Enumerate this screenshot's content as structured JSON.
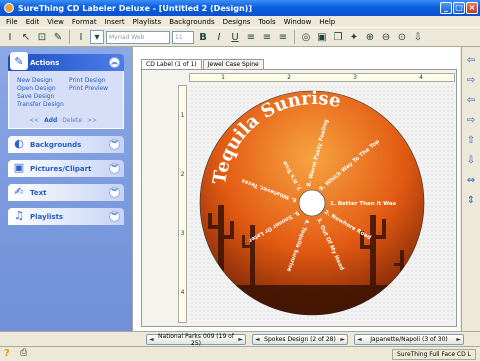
{
  "window": {
    "title": "SureThing CD Labeler Deluxe - [Untitled 2 (Design)]",
    "minimize": "_",
    "maximize": "□",
    "close": "×"
  },
  "menu": [
    "File",
    "Edit",
    "View",
    "Format",
    "Insert",
    "Playlists",
    "Backgrounds",
    "Designs",
    "Tools",
    "Window",
    "Help"
  ],
  "toolbar": {
    "font": "Myriad Web",
    "size": "11",
    "bold": "B",
    "italic": "I",
    "underline": "U"
  },
  "panel": {
    "actions": {
      "title": "Actions",
      "links": [
        "New Design",
        "Print Design",
        "Open Design",
        "Print Preview",
        "Save Design",
        "",
        "Transfer Design",
        ""
      ],
      "add": "Add",
      "delete": "Delete",
      "arrows": "<< >>"
    },
    "sections": [
      "Backgrounds",
      "Pictures/Clipart",
      "Text",
      "Playlists"
    ]
  },
  "tabs": [
    "CD Label (1 of 1)",
    "Jewel Case Spine"
  ],
  "ruler": {
    "h": [
      "1",
      "2",
      "3",
      "4"
    ],
    "v": [
      "1",
      "2",
      "3",
      "4"
    ]
  },
  "label": {
    "title": "Tequila Sunrise",
    "tracks": [
      "1. Better Than It Was",
      "2. Nowhere Road",
      "3. Out Of My Head",
      "4. Tequila Sunrise",
      "5. Sooner Or Later",
      "6. Whatever, Texas",
      "7. It's True",
      "8. Warm Fuzzy Feeling",
      "9. Which Way To The Top"
    ],
    "colors": {
      "top": "#f7a341",
      "mid": "#e25a12",
      "bottom": "#6e1e06"
    }
  },
  "bottom_bar": {
    "background": "National Parks 009 (19 of 25)",
    "design": "Spokes Design (2 of 28)",
    "layout": "Japanette/Napoli (3 of 30)"
  },
  "status": {
    "format": "SureThing Full Face CD L"
  }
}
